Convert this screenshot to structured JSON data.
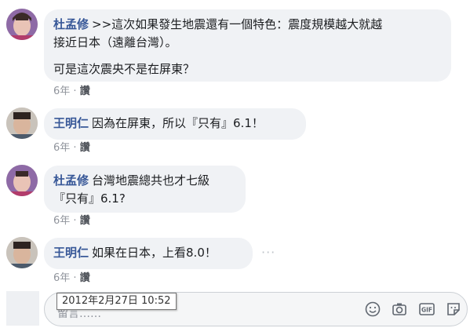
{
  "comments": [
    {
      "author": "杜孟修",
      "line1": ">>這次如果發生地震還有一個特色：震度規模越大就越",
      "line2": "接近日本（遠離台灣）。",
      "line3": "可是這次震央不是在屏東？",
      "time": "6年",
      "like": "讚"
    },
    {
      "author": "王明仁",
      "line1": "因為在屏東，所以『只有』6.1！",
      "time": "6年",
      "like": "讚"
    },
    {
      "author": "杜孟修",
      "line1": "台灣地震總共也才七級",
      "line2": "『只有』6.1?",
      "time": "6年",
      "like": "讚"
    },
    {
      "author": "王明仁",
      "line1": "如果在日本，上看8.0！",
      "time": "6年",
      "like": "讚",
      "more": "···"
    }
  ],
  "composer": {
    "placeholder": "留言……",
    "tooltip": "2012年2月27日 10:52",
    "icons": [
      "emoji-icon",
      "camera-icon",
      "gif-icon",
      "sticker-icon"
    ]
  },
  "separator": "·",
  "colors": {
    "name": "#385898",
    "bubble": "#f0f2f5",
    "meta": "#90949c"
  }
}
